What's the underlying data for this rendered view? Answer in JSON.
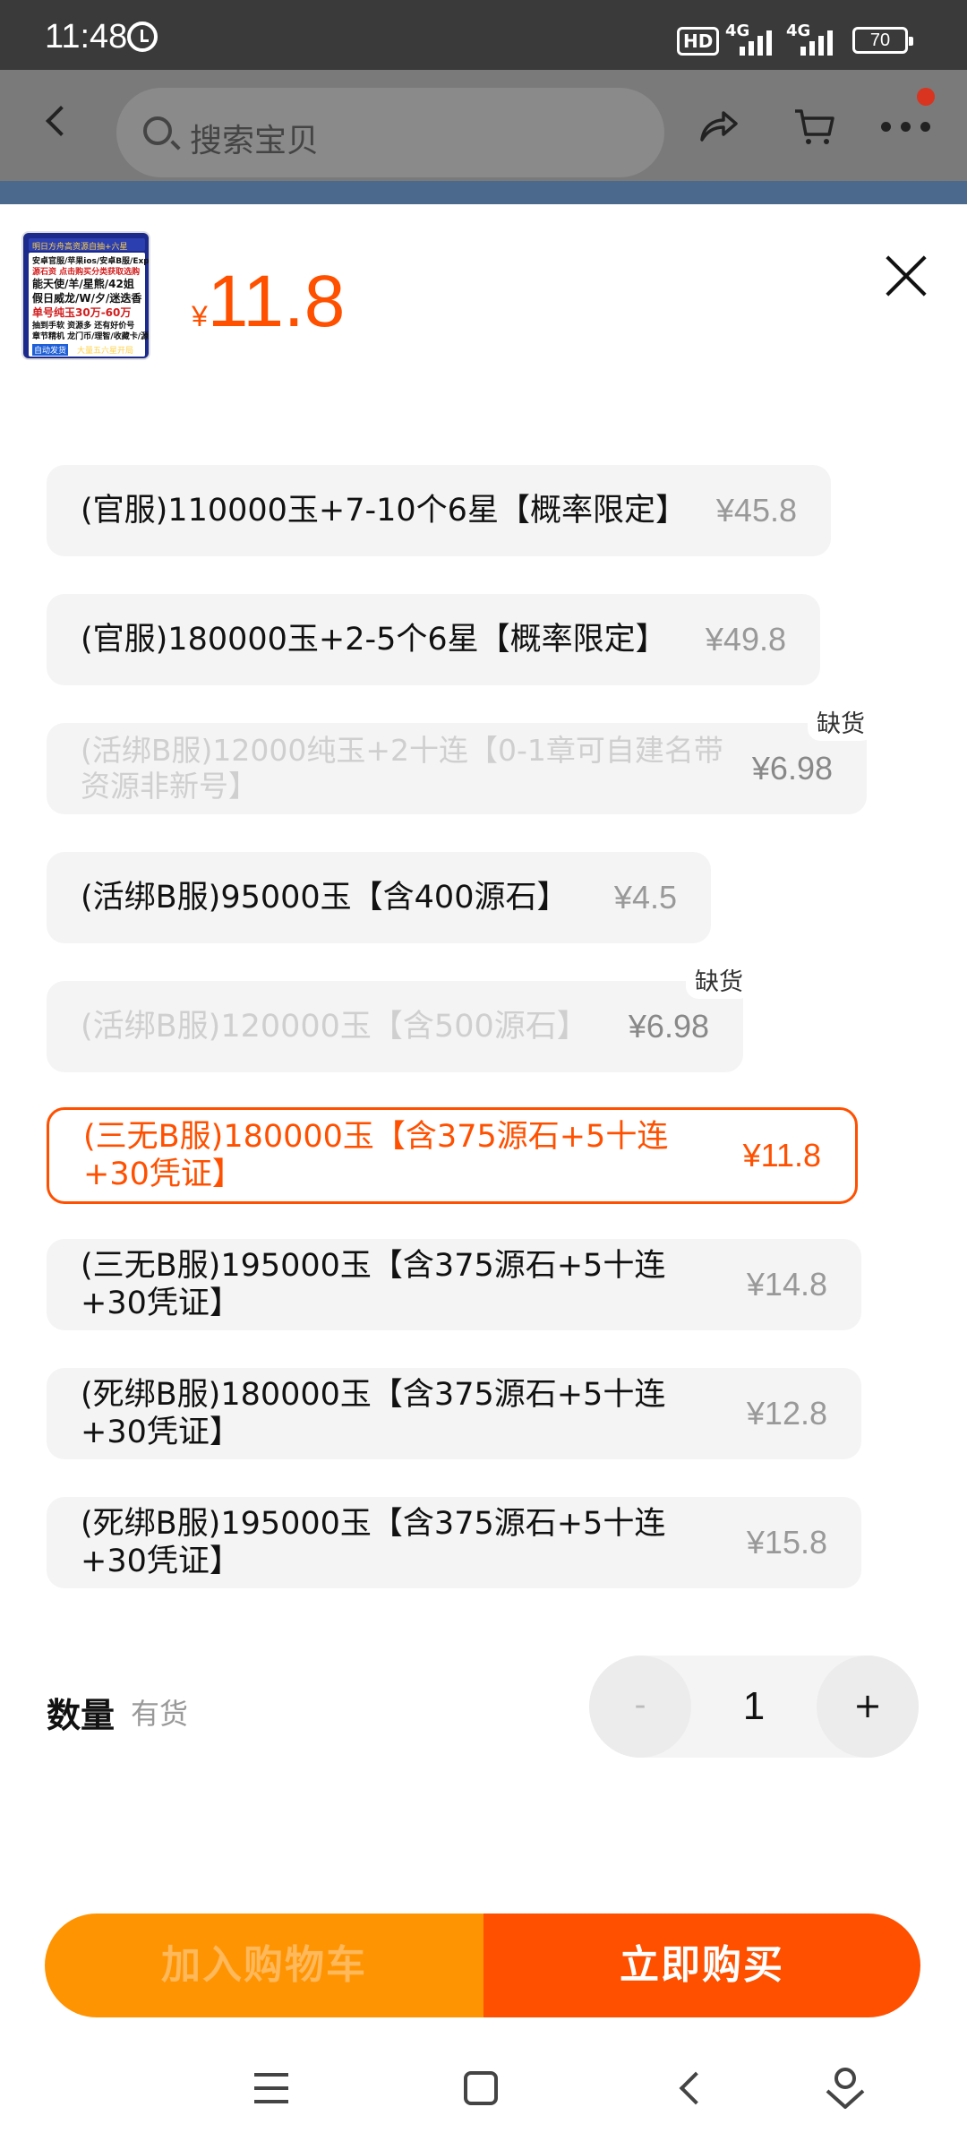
{
  "status_bar": {
    "time": "11:48",
    "network": "4G",
    "network2": "4G",
    "hd_label": "HD",
    "battery": "70"
  },
  "header": {
    "search_placeholder": "搜索宝贝"
  },
  "product": {
    "thumb_lines": [
      "明日方舟高资源自抽+六星",
      "安卓官服/苹果ios/安卓B服/Exp",
      "源石资 点击购买分类获取选购",
      "能天使/羊/星熊/42姐",
      "假日威龙/W/夕/迷迭香",
      "单号纯玉30万-60万",
      "抽到手软 资源多 还有好价号",
      "章节精机 龙门币/理智/收藏卡/源石",
      "自动发货",
      "大量五六星开局"
    ],
    "price_symbol": "¥",
    "price": "11.8"
  },
  "options": [
    {
      "name": "(官服)110000玉+7-10个6星【概率限定】",
      "price": "¥45.8",
      "state": "normal"
    },
    {
      "name": "(官服)180000玉+2-5个6星【概率限定】",
      "price": "¥49.8",
      "state": "normal"
    },
    {
      "name": "(活绑B服)12000纯玉+2十连【0-1章可自建名带资源非新号】",
      "price": "¥6.98",
      "state": "disabled",
      "badge": "缺货"
    },
    {
      "name": "(活绑B服)95000玉【含400源石】",
      "price": "¥4.5",
      "state": "normal"
    },
    {
      "name": "(活绑B服)120000玉【含500源石】",
      "price": "¥6.98",
      "state": "disabled",
      "badge": "缺货"
    },
    {
      "name": "(三无B服)180000玉【含375源石+5十连+30凭证】",
      "price": "¥11.8",
      "state": "selected"
    },
    {
      "name": "(三无B服)195000玉【含375源石+5十连+30凭证】",
      "price": "¥14.8",
      "state": "normal"
    },
    {
      "name": "(死绑B服)180000玉【含375源石+5十连+30凭证】",
      "price": "¥12.8",
      "state": "normal"
    },
    {
      "name": "(死绑B服)195000玉【含375源石+5十连+30凭证】",
      "price": "¥15.8",
      "state": "normal"
    }
  ],
  "quantity": {
    "label": "数量",
    "stock": "有货",
    "minus": "-",
    "value": "1",
    "plus": "+"
  },
  "actions": {
    "add_to_cart": "加入购物车",
    "buy_now": "立即购买"
  },
  "colors": {
    "accent": "#ff5000",
    "cart": "#ff9402"
  }
}
